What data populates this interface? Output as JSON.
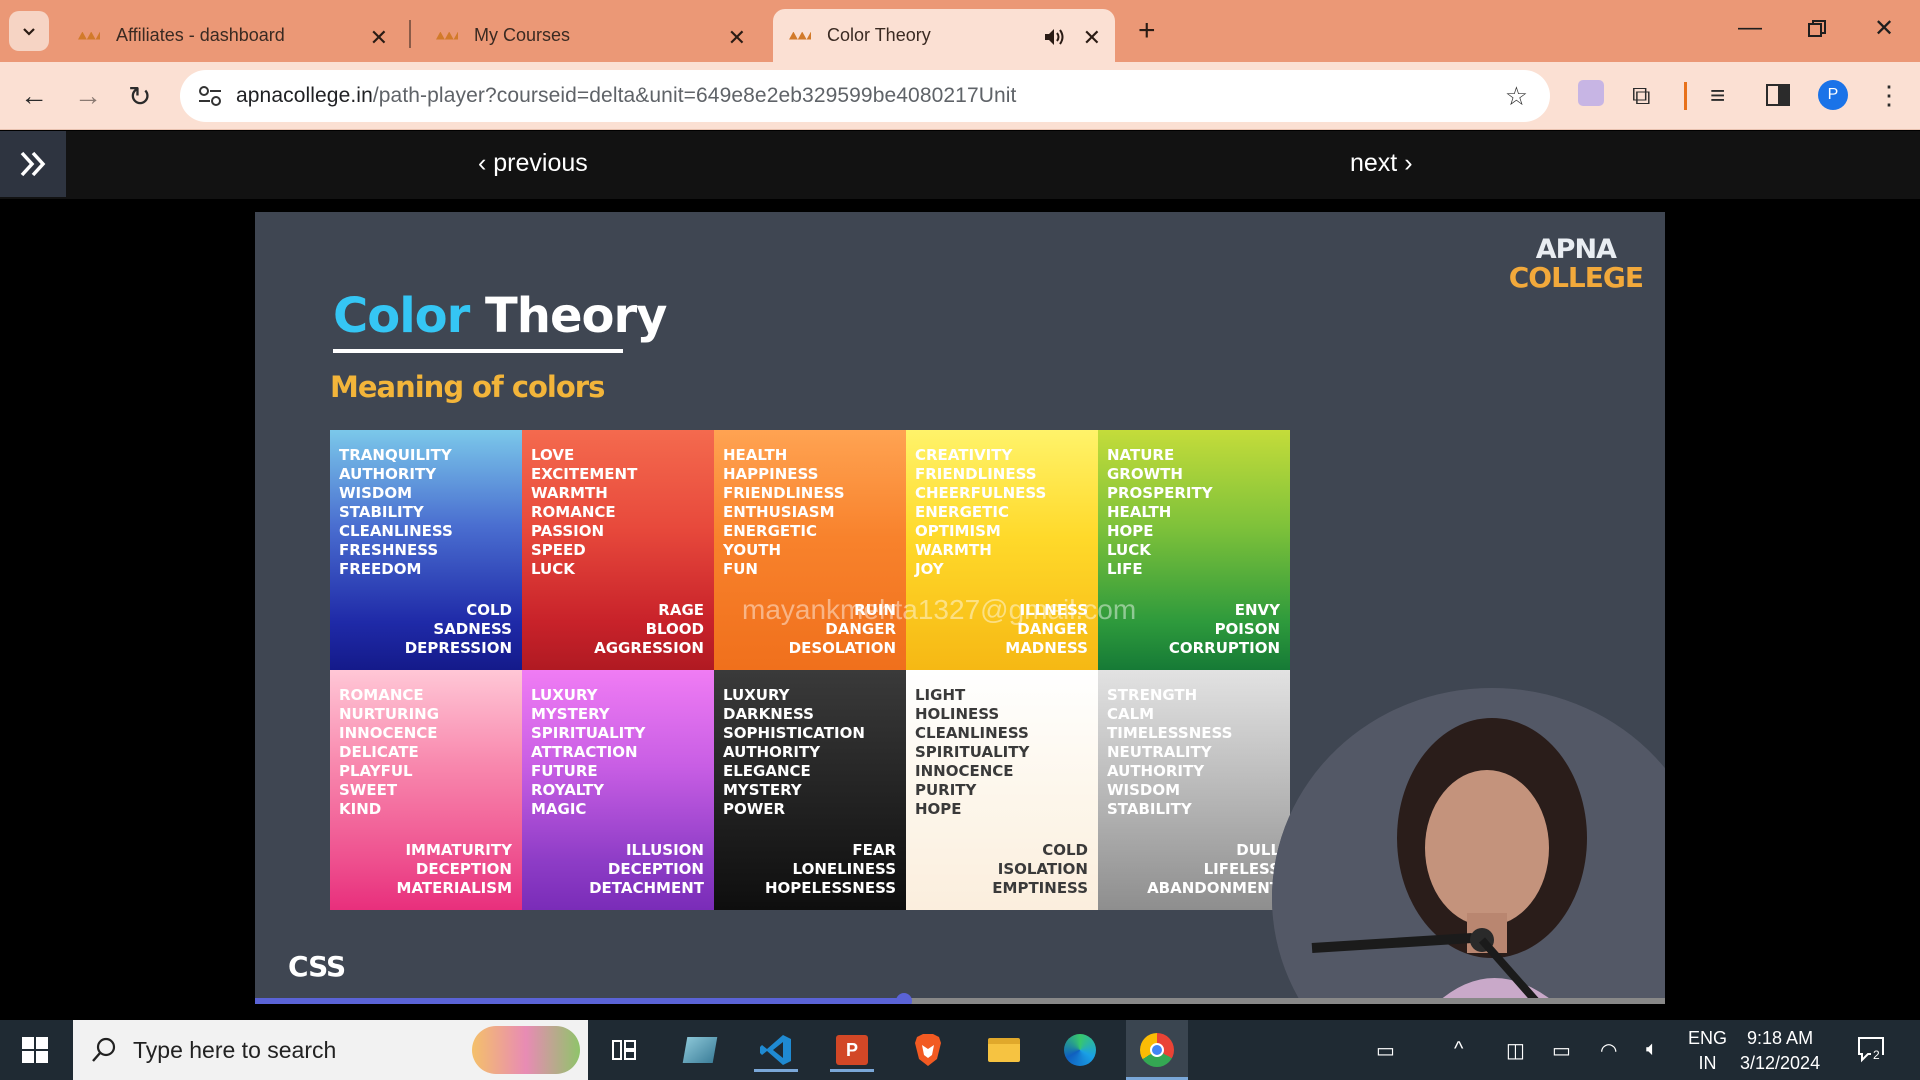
{
  "tabs": [
    {
      "title": "Affiliates - dashboard"
    },
    {
      "title": "My Courses"
    },
    {
      "title": "Color Theory"
    }
  ],
  "address_bar": {
    "domain": "apnacollege.in",
    "path": "/path-player?courseid=delta&unit=649e8e2eb329599be4080217Unit"
  },
  "player_nav": {
    "previous": "previous",
    "next": "next"
  },
  "slide": {
    "brand_line1": "APNA",
    "brand_line2": "COLLEGE",
    "title_color": "Color",
    "title_theory": "Theory",
    "subtitle": "Meaning of colors",
    "watermark": "mayankmehta1327@gmail.com",
    "footer": "CSS",
    "cells": [
      {
        "bg": "linear-gradient(180deg,#7bc8ea 0%,#4a6ed0 40%,#1f2aa8 80%,#141a8a 100%)",
        "text": "#ffffff",
        "top": [
          "Tranquility",
          "Authority",
          "Wisdom",
          "Stability",
          "Cleanliness",
          "Freshness",
          "Freedom"
        ],
        "bottom": [
          "Cold",
          "Sadness",
          "Depression"
        ]
      },
      {
        "bg": "linear-gradient(180deg,#f46a4e 0%,#e84a3c 40%,#c8222a 80%,#b01a22 100%)",
        "text": "#ffffff",
        "top": [
          "Love",
          "Excitement",
          "Warmth",
          "Romance",
          "Passion",
          "Speed",
          "Luck"
        ],
        "bottom": [
          "Rage",
          "Blood",
          "Aggression"
        ]
      },
      {
        "bg": "linear-gradient(180deg,#ffa352 0%,#f8822c 45%,#f0701c 100%)",
        "text": "#ffffff",
        "top": [
          "Health",
          "Happiness",
          "Friendliness",
          "Enthusiasm",
          "Energetic",
          "Youth",
          "Fun"
        ],
        "bottom": [
          "Ruin",
          "Danger",
          "Desolation"
        ]
      },
      {
        "bg": "linear-gradient(180deg,#fff36a 0%,#ffd92a 45%,#f6b814 100%)",
        "text": "#ffffff",
        "top": [
          "Creativity",
          "Friendliness",
          "Cheerfulness",
          "Energetic",
          "Optimism",
          "Warmth",
          "Joy"
        ],
        "bottom": [
          "Illness",
          "Danger",
          "Madness"
        ]
      },
      {
        "bg": "linear-gradient(180deg,#c4dc3a 0%,#7fc23a 40%,#2e9a3c 80%,#167a36 100%)",
        "text": "#ffffff",
        "top": [
          "Nature",
          "Growth",
          "Prosperity",
          "Health",
          "Hope",
          "Luck",
          "Life"
        ],
        "bottom": [
          "Envy",
          "Poison",
          "Corruption"
        ]
      },
      {
        "bg": "linear-gradient(180deg,#ffc7d6 0%,#f887ad 40%,#ee4f8e 80%,#e82f7c 100%)",
        "text": "#ffffff",
        "top": [
          "Romance",
          "Nurturing",
          "Innocence",
          "Delicate",
          "Playful",
          "Sweet",
          "Kind"
        ],
        "bottom": [
          "Immaturity",
          "Deception",
          "Materialism"
        ]
      },
      {
        "bg": "linear-gradient(180deg,#f07cf4 0%,#c85ee4 40%,#8d3cc6 80%,#7a2cb8 100%)",
        "text": "#ffffff",
        "top": [
          "Luxury",
          "Mystery",
          "Spirituality",
          "Attraction",
          "Future",
          "Royalty",
          "Magic"
        ],
        "bottom": [
          "Illusion",
          "Deception",
          "Detachment"
        ]
      },
      {
        "bg": "linear-gradient(180deg,#3a3a3a 0%,#262626 45%,#0e0e0e 100%)",
        "text": "#ffffff",
        "top": [
          "Luxury",
          "Darkness",
          "Sophistication",
          "Authority",
          "Elegance",
          "Mystery",
          "Power"
        ],
        "bottom": [
          "Fear",
          "Loneliness",
          "Hopelessness"
        ]
      },
      {
        "bg": "linear-gradient(180deg,#ffffff 0%,#fdf7ec 50%,#fbeedd 100%)",
        "text": "#3a3a3a",
        "top": [
          "Light",
          "Holiness",
          "Cleanliness",
          "Spirituality",
          "Innocence",
          "Purity",
          "Hope"
        ],
        "bottom": [
          "Cold",
          "Isolation",
          "Emptiness"
        ]
      },
      {
        "bg": "linear-gradient(180deg,#e2e2e2 0%,#bdbdbd 45%,#8e8e8e 100%)",
        "text": "#ffffff",
        "top": [
          "Strength",
          "Calm",
          "Timelessness",
          "Neutrality",
          "Authority",
          "Wisdom",
          "Stability"
        ],
        "bottom": [
          "Dull",
          "Lifeless",
          "Abandonment"
        ]
      }
    ]
  },
  "video": {
    "progress": 0.46
  },
  "taskbar": {
    "search_placeholder": "Type here to search",
    "lang_line1": "ENG",
    "lang_line2": "IN",
    "time": "9:18 AM",
    "date": "3/12/2024",
    "notification_count": "2"
  },
  "colors": {
    "tab_strip": "#eb9876",
    "toolbar": "#fbe0d3",
    "player_bar": "#121212",
    "slide_bg": "#3f4652",
    "progress": "#5a63d6"
  }
}
